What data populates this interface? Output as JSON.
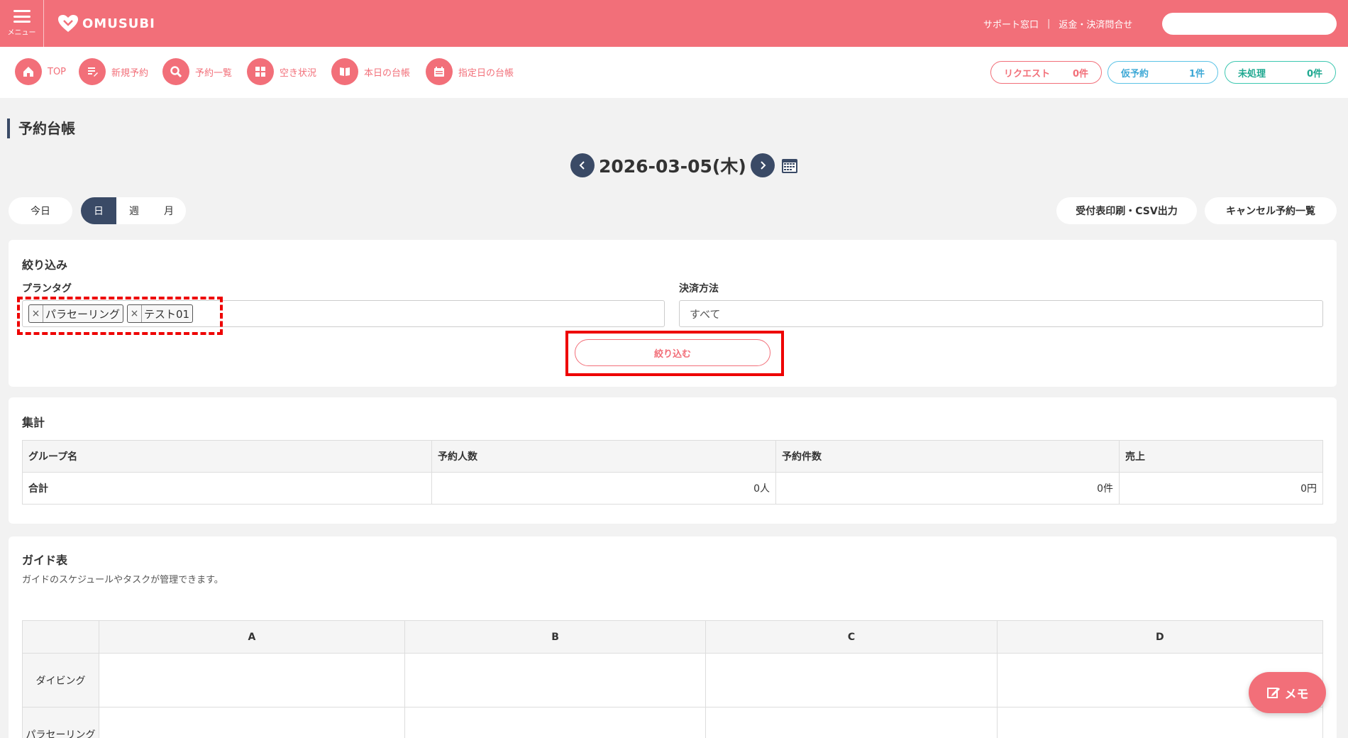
{
  "header": {
    "menu_label": "メニュー",
    "logo_text": "OMUSUBI",
    "support_link": "サポート窓口",
    "separator": "|",
    "refund_link": "返金・決済問合せ"
  },
  "nav": {
    "items": [
      {
        "label": "TOP",
        "icon": "home-icon"
      },
      {
        "label": "新規予約",
        "icon": "edit-icon"
      },
      {
        "label": "予約一覧",
        "icon": "search-icon"
      },
      {
        "label": "空き状況",
        "icon": "grid-icon"
      },
      {
        "label": "本日の台帳",
        "icon": "book-icon"
      },
      {
        "label": "指定日の台帳",
        "icon": "calendar-icon"
      }
    ],
    "status": {
      "request_label": "リクエスト",
      "request_count": "0件",
      "temp_label": "仮予約",
      "temp_count": "1件",
      "unprocessed_label": "未処理",
      "unprocessed_count": "0件"
    }
  },
  "page": {
    "title": "予約台帳",
    "date": "2026-03-05(木)",
    "today_label": "今日",
    "view_day": "日",
    "view_week": "週",
    "view_month": "月",
    "print_label": "受付表印刷・CSV出力",
    "cancel_list_label": "キャンセル予約一覧"
  },
  "filter": {
    "title": "絞り込み",
    "plan_tag_label": "プランタグ",
    "tags": [
      "パラセーリング",
      "テスト01"
    ],
    "tag_remove": "×",
    "payment_label": "決済方法",
    "payment_value": "すべて",
    "submit_label": "絞り込む"
  },
  "summary": {
    "title": "集計",
    "columns": [
      "グループ名",
      "予約人数",
      "予約件数",
      "売上"
    ],
    "rows": [
      {
        "name": "合計",
        "people": "0人",
        "count": "0件",
        "sales": "0円"
      }
    ]
  },
  "guide": {
    "title": "ガイド表",
    "description": "ガイドのスケジュールやタスクが管理できます。",
    "columns": [
      "A",
      "B",
      "C",
      "D"
    ],
    "rows": [
      "ダイビング",
      "パラセーリング"
    ]
  },
  "memo_label": "メモ",
  "colors": {
    "brand": "#f26f79",
    "navy": "#3a4a66",
    "temp": "#5bc3e6",
    "unprocessed": "#3cc7b0"
  }
}
